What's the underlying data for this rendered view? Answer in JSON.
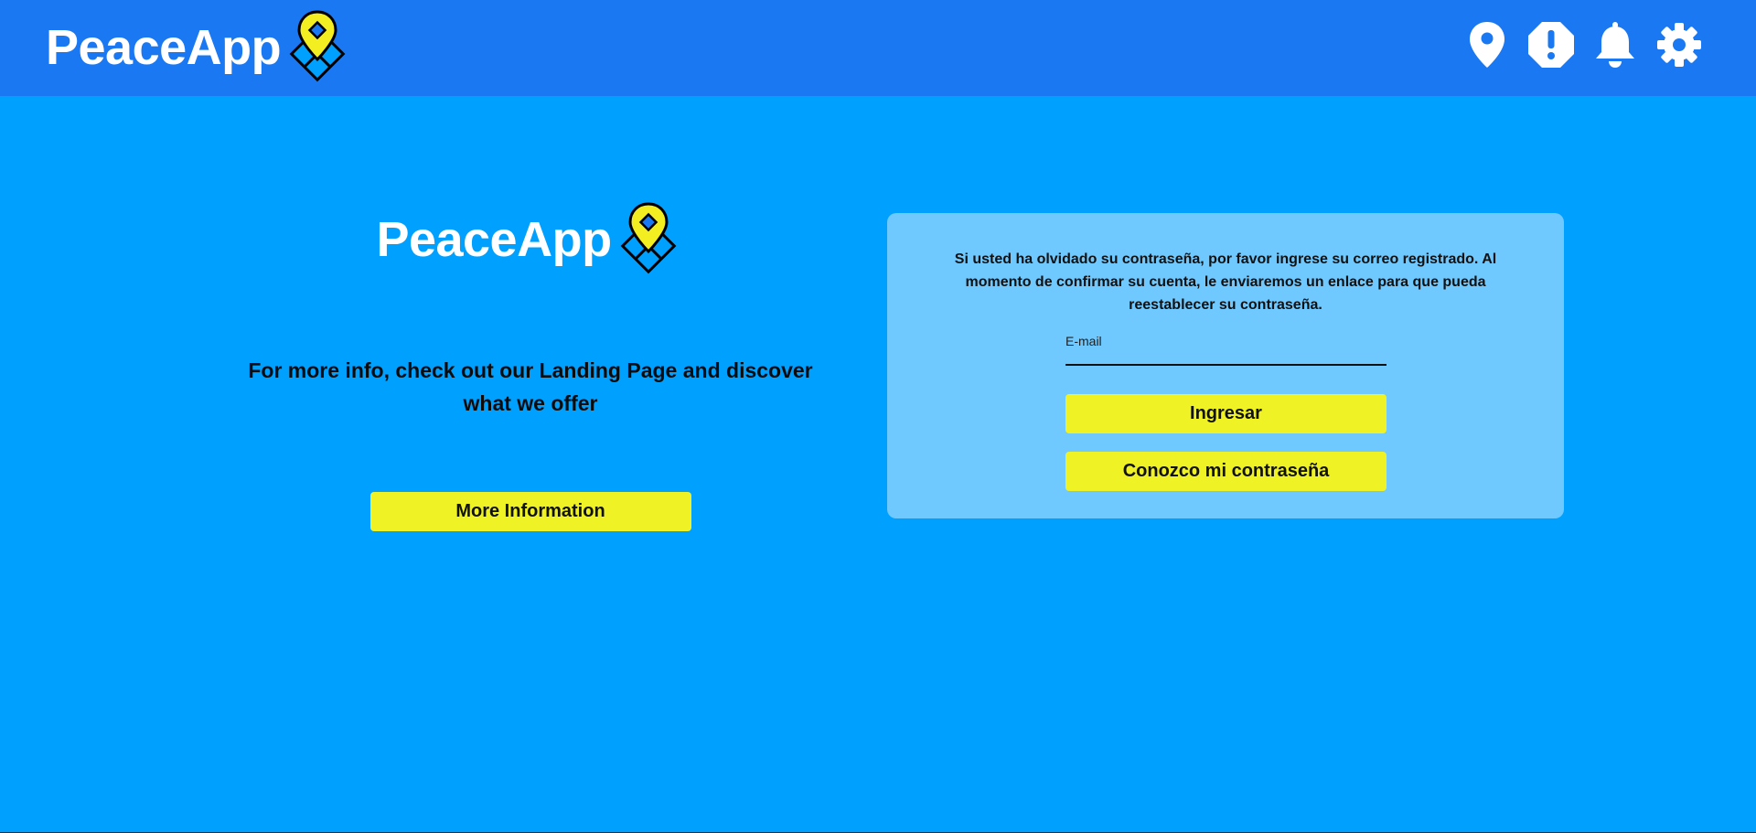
{
  "header": {
    "brand": "PeaceApp",
    "icons": [
      "location-pin-icon",
      "alert-octagon-icon",
      "bell-icon",
      "gear-icon"
    ]
  },
  "left": {
    "brand": "PeaceApp",
    "info": "For more info, check out our Landing Page and discover what we offer",
    "more_button": "More Information"
  },
  "card": {
    "message": "Si usted ha olvidado su contraseña, por favor ingrese su correo registrado. Al momento de confirmar su cuenta, le enviaremos un enlace para que pueda reestablecer su contraseña.",
    "email_placeholder": "E-mail",
    "email_value": "",
    "submit_button": "Ingresar",
    "know_password_button": "Conozco mi contraseña"
  },
  "colors": {
    "header_bg": "#1a78f2",
    "page_bg": "#00a0ff",
    "card_bg": "#6fc9ff",
    "button_bg": "#eff224"
  }
}
